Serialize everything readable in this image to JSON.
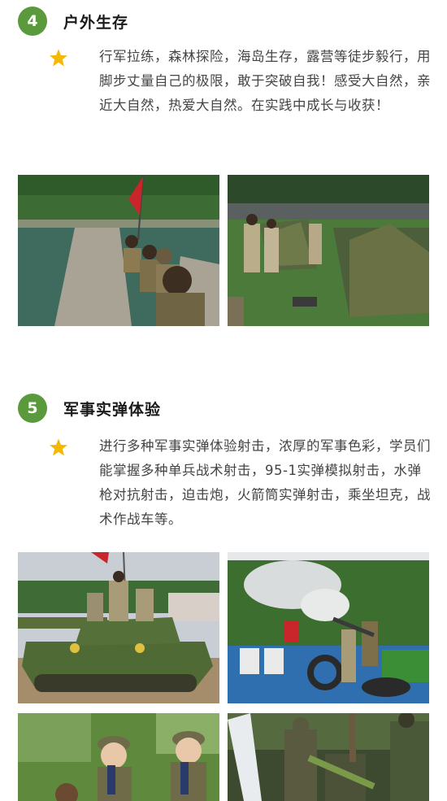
{
  "sections": [
    {
      "number": "4",
      "title": "户外生存",
      "description": "行军拉练，森林探险，海岛生存，露营等徒步毅行，用脚步丈量自己的极限，敢于突破自我！感受大自然，亲近大自然，热爱大自然。在实践中成长与收获！"
    },
    {
      "number": "5",
      "title": "军事实弹体验",
      "description": "进行多种军事实弹体验射击，浓厚的军事色彩，学员们能掌握多种单兵战术射击，95-1实弹模拟射击，水弹枪对抗射击，迫击炮，火箭筒实弹射击，乘坐坦克，战术作战车等。"
    }
  ],
  "colors": {
    "badge": "#5a9a3c",
    "star": "#f5b800",
    "camo_dark": "#4a5a3a",
    "camo_light": "#8a8a5a"
  },
  "icons": {
    "bullet": "star-icon"
  }
}
